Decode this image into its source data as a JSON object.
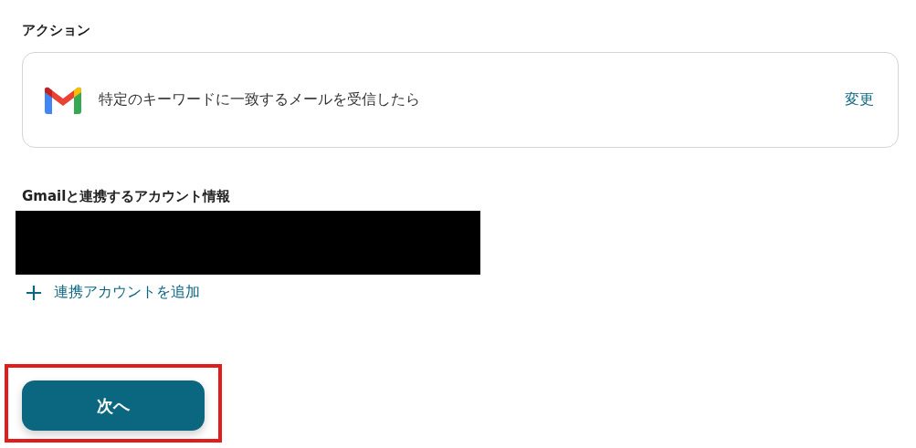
{
  "action_section": {
    "heading": "アクション",
    "card": {
      "title": "特定のキーワードに一致するメールを受信したら",
      "change_link": "変更"
    }
  },
  "account_section": {
    "heading": "Gmailと連携するアカウント情報",
    "redacted": true,
    "add_link": "連携アカウントを追加"
  },
  "next_button": {
    "label": "次へ",
    "highlighted": true
  }
}
